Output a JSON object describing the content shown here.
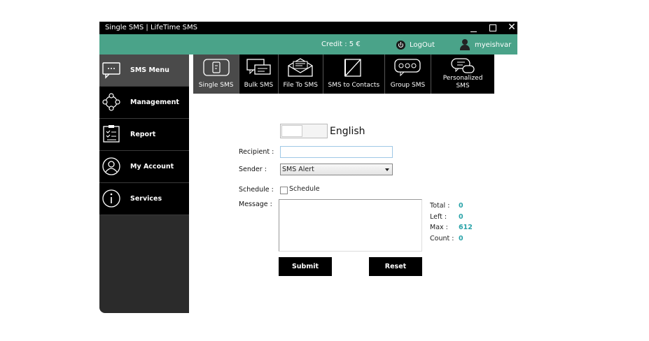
{
  "window": {
    "title": "Single SMS | LifeTime SMS"
  },
  "topbar": {
    "credit": "Credit :  5 €",
    "logout": "LogOut",
    "username": "myeishvar"
  },
  "sidebar": {
    "items": [
      {
        "label": "SMS Menu",
        "icon": "chat-bubble-icon"
      },
      {
        "label": "Management",
        "icon": "network-icon"
      },
      {
        "label": "Report",
        "icon": "clipboard-icon"
      },
      {
        "label": "My Account",
        "icon": "user-icon"
      },
      {
        "label": "Services",
        "icon": "info-icon"
      }
    ]
  },
  "tabs": [
    {
      "label": "Single SMS",
      "icon": "phone-message-icon"
    },
    {
      "label": "Bulk SMS",
      "icon": "multiple-messages-icon"
    },
    {
      "label": "File To SMS",
      "icon": "envelope-icon"
    },
    {
      "label": "SMS to Contacts",
      "icon": "contacts-book-icon"
    },
    {
      "label": "Group SMS",
      "icon": "group-chat-icon"
    },
    {
      "label": "Personalized SMS",
      "icon": "personal-chat-icon"
    }
  ],
  "form": {
    "language": "English",
    "recipient_label": "Recipient :",
    "recipient_value": "",
    "sender_label": "Sender :",
    "sender_value": "SMS Alert",
    "schedule_label": "Schedule :",
    "schedule_checkbox_label": "Schedule",
    "message_label": "Message :",
    "counts": [
      {
        "label": "Total :",
        "value": "0"
      },
      {
        "label": "Left :",
        "value": "0"
      },
      {
        "label": "Max :",
        "value": "612"
      },
      {
        "label": "Count :",
        "value": "0"
      }
    ],
    "submit_label": "Submit",
    "reset_label": "Reset"
  },
  "colors": {
    "accent": "#4aa389",
    "count_value": "#2aa3a9",
    "dark": "#000000"
  }
}
